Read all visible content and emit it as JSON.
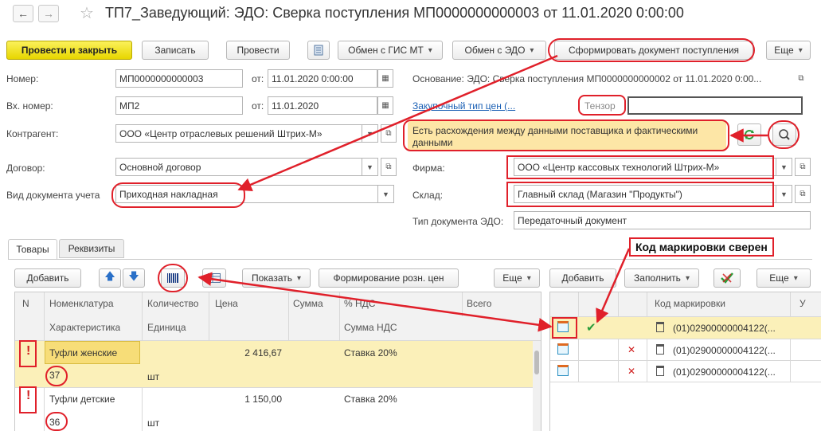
{
  "window": {
    "title": "ТП7_Заведующий: ЭДО: Сверка поступления МП0000000000003 от 11.01.2020 0:00:00"
  },
  "toolbar": {
    "post_close": "Провести и закрыть",
    "save": "Записать",
    "post": "Провести",
    "gis_mt": "Обмен с ГИС МТ",
    "edo": "Обмен с ЭДО",
    "form_doc": "Сформировать документ поступления",
    "more": "Еще"
  },
  "form": {
    "number_label": "Номер:",
    "number_value": "МП0000000000003",
    "date_label": "от:",
    "date_value": "11.01.2020  0:00:00",
    "in_number_label": "Вх. номер:",
    "in_number_value": "МП2",
    "in_date_label": "от:",
    "in_date_value": "11.01.2020",
    "basis_text": "Основание: ЭДО: Сверка поступления МП0000000000002 от 11.01.2020 0:00...",
    "price_type_link": "Закупочный тип цен (...",
    "provider_label": "Тензор",
    "counterparty_label": "Контрагент:",
    "counterparty_value": "ООО «Центр отраслевых решений Штрих-М»",
    "warning_text": "Есть расхождения между данными поставщика и фактическими данными",
    "contract_label": "Договор:",
    "contract_value": "Основной договор",
    "firm_label": "Фирма:",
    "firm_value": "ООО «Центр кассовых технологий Штрих-М»",
    "doc_kind_label": "Вид документа учета",
    "doc_kind_value": "Приходная накладная",
    "warehouse_label": "Склад:",
    "warehouse_value": "Главный склад (Магазин \"Продукты\")",
    "edo_doc_type_label": "Тип документа ЭДО:",
    "edo_doc_type_value": "Передаточный документ"
  },
  "tabs": {
    "goods": "Товары",
    "props": "Реквизиты"
  },
  "goods_toolbar": {
    "add": "Добавить",
    "show": "Показать",
    "retail_prices": "Формирование розн. цен",
    "more": "Еще"
  },
  "goods_table": {
    "col_n": "N",
    "col_nom": "Номенклатура",
    "col_char": "Характеристика",
    "col_qty": "Количество",
    "col_unit": "Единица",
    "col_price": "Цена",
    "col_sum": "Сумма",
    "col_vat": "% НДС",
    "col_vat_sum": "Сумма НДС",
    "col_total": "Всего",
    "rows": [
      {
        "alert": "!",
        "name": "Туфли женские",
        "char": "37",
        "unit": "шт",
        "price": "2 416,67",
        "vat": "Ставка 20%"
      },
      {
        "alert": "!",
        "name": "Туфли детские",
        "char": "36",
        "unit": "шт",
        "price": "1 150,00",
        "vat": "Ставка 20%"
      }
    ]
  },
  "marks_toolbar": {
    "add": "Добавить",
    "fill": "Заполнить",
    "more": "Еще"
  },
  "marks_table": {
    "col_code": "Код маркировки",
    "col_u": "У",
    "rows": [
      {
        "status": "✔",
        "code": "(01)02900000004122(..."
      },
      {
        "status": "✕",
        "code": "(01)02900000004122(..."
      },
      {
        "status": "✕",
        "code": "(01)02900000004122(..."
      }
    ]
  },
  "callout": {
    "text": "Код маркировки сверен"
  },
  "colors": {
    "accent_red": "#e0202a",
    "primary_yellow": "#f5e21c",
    "selected_row": "#fbf0b9",
    "warning_bg": "#fde6a6"
  }
}
